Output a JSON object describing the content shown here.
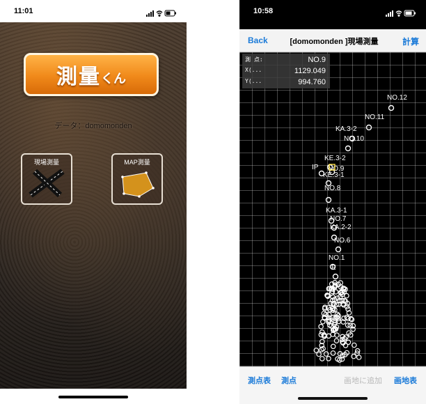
{
  "left": {
    "status": {
      "time": "11:01"
    },
    "logo": {
      "main": "測量",
      "sub": "くん"
    },
    "data_label": "データ：domomonden",
    "menu": [
      {
        "label": "現場測量",
        "icon": "crossroads-icon"
      },
      {
        "label": "MAP測量",
        "icon": "land-parcel-icon"
      }
    ]
  },
  "right": {
    "status": {
      "time": "10:58"
    },
    "nav": {
      "back": "Back",
      "title": "[domomonden ]現場測量",
      "calc": "計算"
    },
    "info": [
      {
        "key": "測 点:",
        "value": "NO.9"
      },
      {
        "key": "X(...",
        "value": "1129.049"
      },
      {
        "key": "Y(...",
        "value": "994.760"
      }
    ],
    "points": [
      {
        "label": "NO.12"
      },
      {
        "label": "NO.11"
      },
      {
        "label": "KA.3-2"
      },
      {
        "label": "NO.10"
      },
      {
        "label": "IP"
      },
      {
        "label": "KE.3-2"
      },
      {
        "label": "NO.9"
      },
      {
        "label": "KE.3-1"
      },
      {
        "label": "NO.8"
      },
      {
        "label": "KA.3-1"
      },
      {
        "label": "NO.7"
      },
      {
        "label": "KA.2-2"
      },
      {
        "label": "NO.6"
      },
      {
        "label": "NO.1"
      },
      {
        "label": "E"
      }
    ],
    "toolbar": {
      "points_table": "測点表",
      "points": "測点",
      "add_to_map": "画地に追加",
      "map_table": "画地表"
    }
  }
}
